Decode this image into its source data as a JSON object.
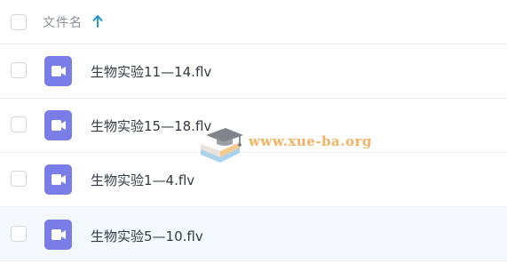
{
  "header": {
    "column_title": "文件名",
    "sort_icon": "arrow-up-icon",
    "accent_color": "#2196d8"
  },
  "files": [
    {
      "name": "生物实验11—14.flv",
      "icon": "video-file-icon",
      "selected": false
    },
    {
      "name": "生物实验15—18.flv",
      "icon": "video-file-icon",
      "selected": false
    },
    {
      "name": "生物实验1—4.flv",
      "icon": "video-file-icon",
      "selected": false
    },
    {
      "name": "生物实验5—10.flv",
      "icon": "video-file-icon",
      "selected": true
    }
  ],
  "watermark": {
    "text": "www.xue-ba.org",
    "icon": "graduation-cap-books-logo",
    "color": "#f3aa52"
  },
  "file_icon_color": "#7a7de8"
}
